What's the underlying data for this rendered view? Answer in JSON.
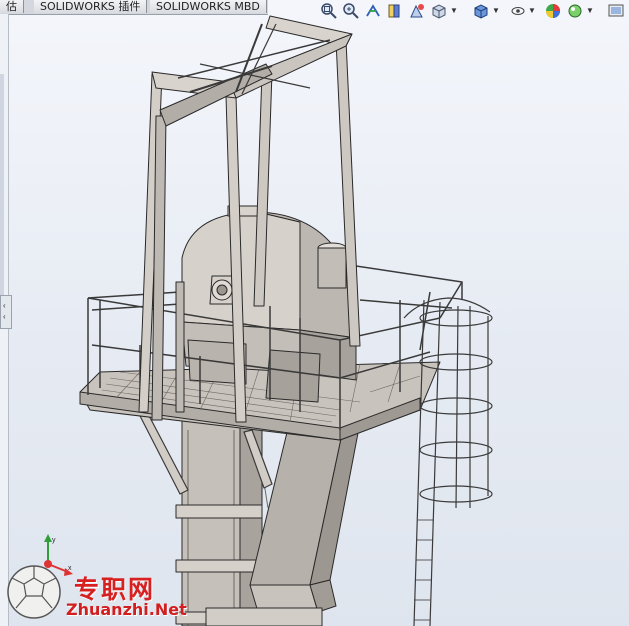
{
  "tabs": [
    {
      "label": "估"
    },
    {
      "label": "SOLIDWORKS 插件"
    },
    {
      "label": "SOLIDWORKS MBD"
    }
  ],
  "toolbar_icons": [
    "zoom-to-fit-icon",
    "zoom-to-area-icon",
    "previous-view-icon",
    "section-view-icon",
    "dynamic-annotation-icon",
    "view-orientation-icon",
    "display-style-icon",
    "hide-show-items-icon",
    "edit-appearance-icon",
    "apply-scene-icon",
    "view-settings-icon"
  ],
  "colors": {
    "background_top": "#f4f6fb",
    "background_bottom": "#dfe5ee",
    "model_fill": "#cdc7c1",
    "model_edge": "#2a2a2a",
    "watermark": "#d82020"
  },
  "triad": {
    "x": "x",
    "y": "y",
    "z": "z"
  },
  "watermark": {
    "cn": "专职网",
    "en": "Zhuanzhi.Net"
  }
}
